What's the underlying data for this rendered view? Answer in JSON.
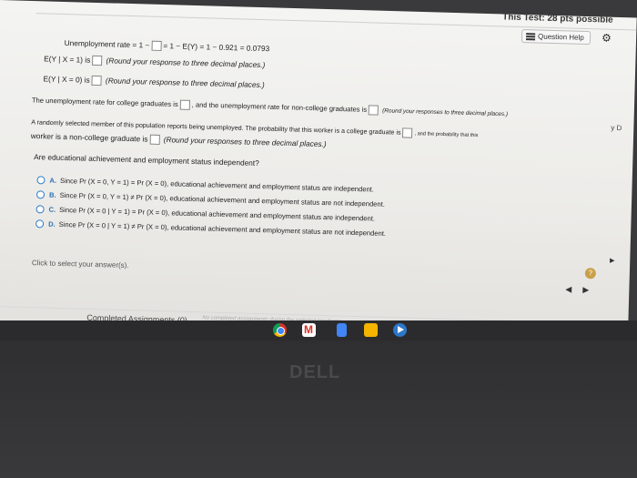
{
  "header": {
    "test_title": "This Test: 28 pts possible",
    "question_help_label": "Question Help"
  },
  "lines": {
    "unemployment_rate_prefix": "Unemployment rate = 1 −",
    "unemployment_rate_suffix": "= 1 − E(Y) = 1 − 0.921 = 0.0793",
    "e_y_x1_prefix": "E(Y | X = 1) is",
    "e_y_x1_hint": "(Round your response to three decimal places.)",
    "e_y_x0_prefix": "E(Y | X = 0) is",
    "e_y_x0_hint": "(Round your response to three decimal places.)",
    "rate_college_prefix": "The unemployment rate for college graduates is",
    "rate_college_mid": ", and the unemployment rate for non-college graduates is",
    "rate_college_hint": "(Round your responses to three decimal places.)",
    "random_member_text": "A randomly selected member of this population reports being unemployed. The probability that this worker is a college graduate is",
    "random_member_tail": ", and the probability that this",
    "noncollege_prefix": "worker is a non-college graduate is",
    "noncollege_hint": "(Round your responses to three decimal places.)",
    "independence_question": "Are educational achievement and employment status independent?"
  },
  "options": [
    {
      "letter": "A.",
      "text": "Since Pr (X = 0, Y = 1) = Pr (X = 0), educational achievement and employment status are independent."
    },
    {
      "letter": "B.",
      "text": "Since Pr (X = 0, Y = 1) ≠ Pr (X = 0), educational achievement and employment status are not independent."
    },
    {
      "letter": "C.",
      "text": "Since Pr (X = 0 | Y = 1) = Pr (X = 0), educational achievement and employment status are independent."
    },
    {
      "letter": "D.",
      "text": "Since Pr (X = 0 | Y = 1) ≠ Pr (X = 0), educational achievement and employment status are not independent."
    }
  ],
  "footer": {
    "click_hint": "Click to select your answer(s).",
    "help_symbol": "?",
    "completed_assignments": "Completed Assignments (0)",
    "completed_note": "No completed assignments during the selected timeframe",
    "side_letters": "y    D"
  },
  "brand": {
    "laptop_logo": "DELL"
  },
  "colors": {
    "accent_blue": "#2a6fb0",
    "help_gold": "#c9a048"
  }
}
